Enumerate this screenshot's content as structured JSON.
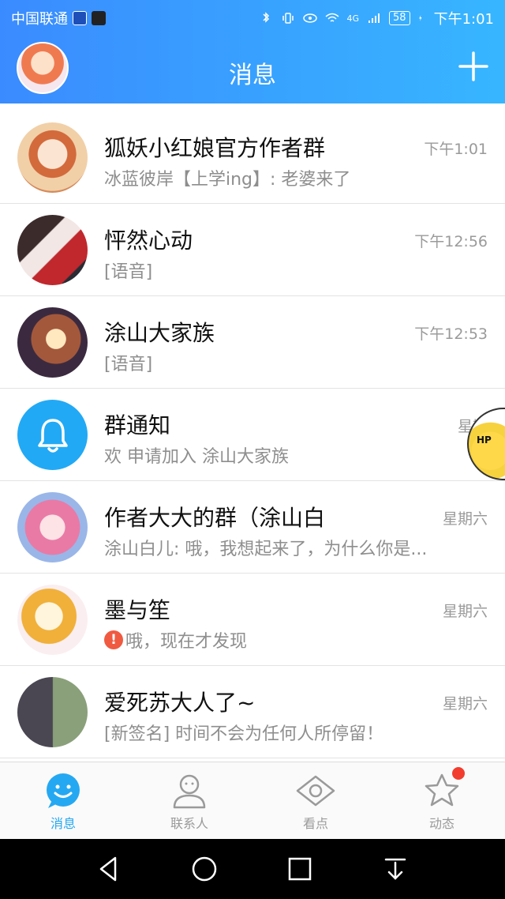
{
  "status_bar": {
    "carrier": "中国联通",
    "network": "4G",
    "battery": "58",
    "time": "下午1:01"
  },
  "header": {
    "title": "消息",
    "add_icon": "plus-icon"
  },
  "conversations": [
    {
      "name": "狐妖小红娘官方作者群",
      "time": "下午1:01",
      "preview": "冰蓝彼岸【上学ing】: 老婆来了",
      "avatar": "anime-avatar"
    },
    {
      "name": "怦然心动",
      "time": "下午12:56",
      "preview": "[语音]",
      "avatar": "anime-avatar"
    },
    {
      "name": "涂山大家族",
      "time": "下午12:53",
      "preview": "[语音]",
      "avatar": "anime-avatar"
    },
    {
      "name": "群通知",
      "time": "星期",
      "preview": "欢 申请加入 涂山大家族",
      "avatar": "bell-icon"
    },
    {
      "name": "作者大大的群（涂山白",
      "time": "星期六",
      "preview": "涂山白儿: 哦，我想起来了，为什么你是...",
      "avatar": "anime-avatar"
    },
    {
      "name": "墨与笙",
      "time": "星期六",
      "preview": "哦，现在才发现",
      "avatar": "anime-avatar",
      "alert": "!"
    },
    {
      "name": "爱死苏大人了~",
      "time": "星期六",
      "preview": "[新签名] 时间不会为任何人所停留！",
      "avatar": "photo-avatar"
    }
  ],
  "floating_bubble": {
    "text": "HP",
    "icon": "pikachu-sticker"
  },
  "tabs": [
    {
      "label": "消息",
      "icon": "smile-bubble-icon",
      "active": true
    },
    {
      "label": "联系人",
      "icon": "person-icon",
      "active": false
    },
    {
      "label": "看点",
      "icon": "eye-icon",
      "active": false
    },
    {
      "label": "动态",
      "icon": "star-icon",
      "active": false,
      "badge": true
    }
  ],
  "colors": {
    "header_start": "#3a8bff",
    "header_end": "#37b6ff",
    "accent": "#25a8f2",
    "badge_red": "#f23d2e"
  }
}
